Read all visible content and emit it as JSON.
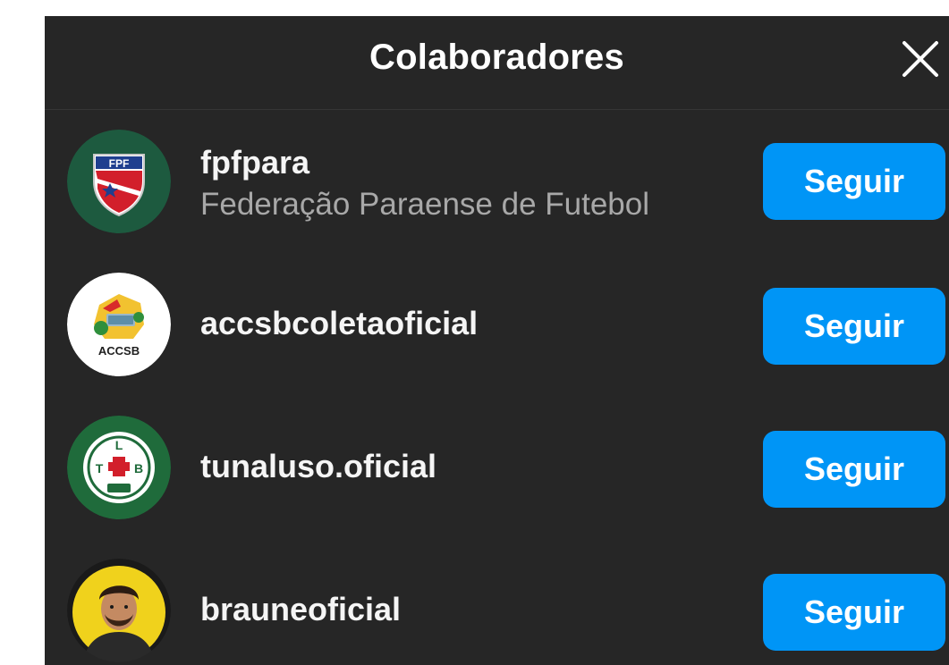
{
  "dialog": {
    "title": "Colaboradores",
    "close_icon": "close-icon"
  },
  "collaborators": [
    {
      "username": "fpfpara",
      "full_name": "Federação Paraense de Futebol",
      "avatar_icon": "fpf-shield-logo",
      "avatar_text": "FPF",
      "button_label": "Seguir"
    },
    {
      "username": "accsbcoletaoficial",
      "full_name": "",
      "avatar_icon": "accsb-logo",
      "avatar_text": "ACCSB",
      "button_label": "Seguir"
    },
    {
      "username": "tunaluso.oficial",
      "full_name": "",
      "avatar_icon": "tuna-luso-crest",
      "avatar_text": "L T B",
      "button_label": "Seguir"
    },
    {
      "username": "brauneoficial",
      "full_name": "",
      "avatar_icon": "person-photo",
      "avatar_text": "",
      "button_label": "Seguir"
    }
  ],
  "colors": {
    "background": "#262626",
    "button": "#0095f6",
    "primary_text": "#f5f5f5",
    "secondary_text": "#a8a8a8"
  }
}
